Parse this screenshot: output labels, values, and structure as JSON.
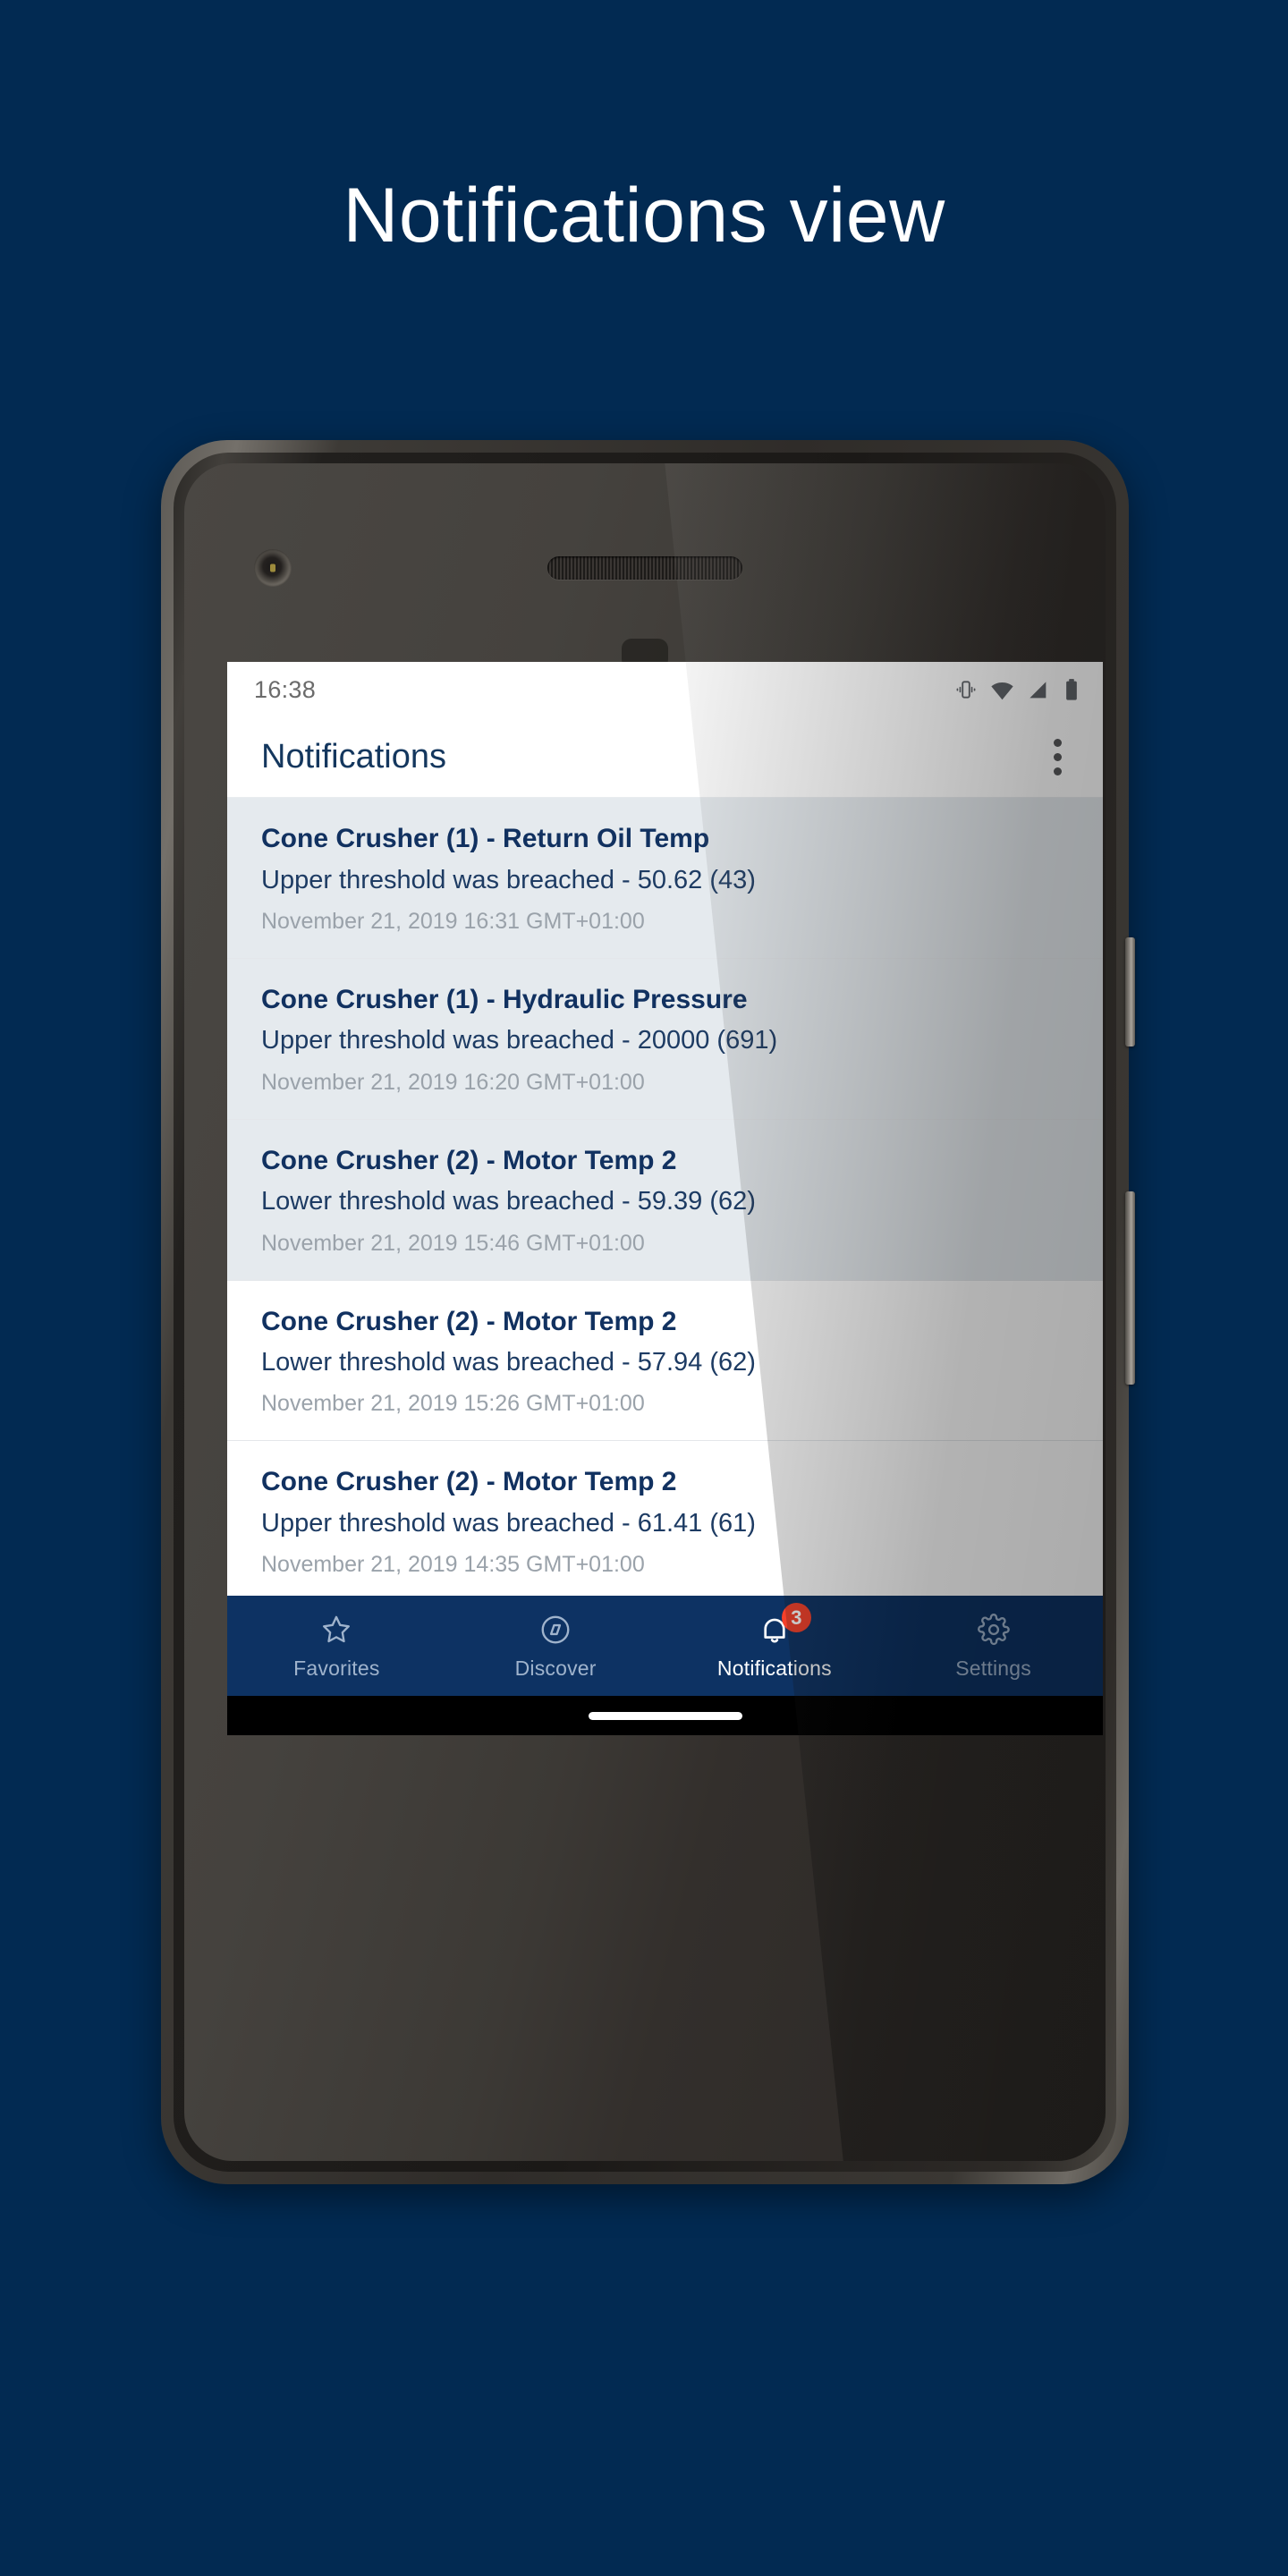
{
  "poster": {
    "title": "Notifications view",
    "background_color": "#022a52"
  },
  "statusbar": {
    "time": "16:38",
    "icons": [
      "vibrate-icon",
      "wifi-icon",
      "signal-icon",
      "battery-icon"
    ]
  },
  "appbar": {
    "title": "Notifications",
    "overflow_icon": "more-vertical-icon"
  },
  "notifications": [
    {
      "title": "Cone Crusher (1) - Return Oil Temp",
      "body": "Upper threshold was breached - 50.62 (43)",
      "time": "November 21, 2019 16:31 GMT+01:00",
      "state": "unread"
    },
    {
      "title": "Cone Crusher (1) - Hydraulic Pressure",
      "body": "Upper threshold was breached - 20000 (691)",
      "time": "November 21, 2019 16:20 GMT+01:00",
      "state": "unread"
    },
    {
      "title": "Cone Crusher (2) - Motor Temp 2",
      "body": "Lower threshold was breached - 59.39 (62)",
      "time": "November 21, 2019 15:46 GMT+01:00",
      "state": "unread"
    },
    {
      "title": "Cone Crusher (2) - Motor Temp 2",
      "body": "Lower threshold was breached - 57.94 (62)",
      "time": "November 21, 2019 15:26 GMT+01:00",
      "state": "read"
    },
    {
      "title": "Cone Crusher (2) - Motor Temp 2",
      "body": "Upper threshold was breached - 61.41 (61)",
      "time": "November 21, 2019 14:35 GMT+01:00",
      "state": "read"
    }
  ],
  "bottom_nav": [
    {
      "label": "Favorites",
      "icon": "star-icon",
      "active": false,
      "badge": null
    },
    {
      "label": "Discover",
      "icon": "compass-icon",
      "active": false,
      "badge": null
    },
    {
      "label": "Notifications",
      "icon": "bell-icon",
      "active": true,
      "badge": "3"
    },
    {
      "label": "Settings",
      "icon": "gear-icon",
      "active": false,
      "badge": null
    }
  ],
  "colors": {
    "poster_background": "#022a52",
    "nav_background": "#0d3263",
    "badge": "#f4402a",
    "unread_row": "#e5eaee",
    "read_row": "#ffffff",
    "title_text": "#113160",
    "timestamp_text": "#9aa2aa"
  }
}
